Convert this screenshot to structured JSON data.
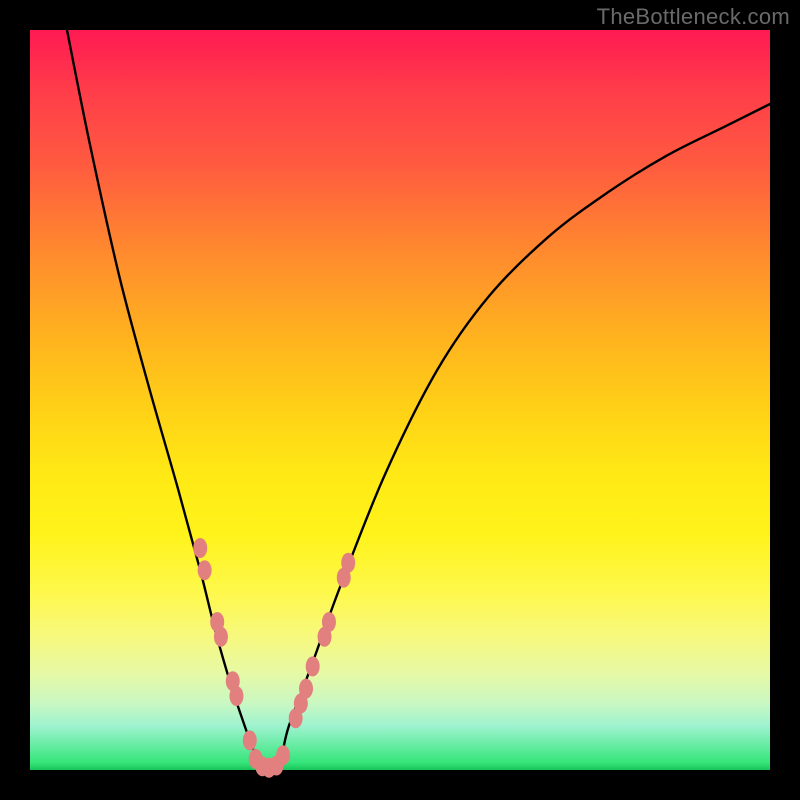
{
  "watermark": "TheBottleneck.com",
  "chart_data": {
    "type": "line",
    "title": "",
    "xlabel": "",
    "ylabel": "",
    "xlim": [
      0,
      100
    ],
    "ylim": [
      0,
      100
    ],
    "grid": false,
    "legend": false,
    "series": [
      {
        "name": "bottleneck-curve",
        "color": "#000000",
        "x": [
          5,
          8,
          12,
          16,
          20,
          23,
          25,
          27,
          29,
          30.5,
          32,
          33,
          34,
          35,
          38,
          42,
          48,
          55,
          62,
          70,
          78,
          86,
          94,
          100
        ],
        "y": [
          100,
          85,
          67,
          52,
          38,
          27,
          19,
          12,
          6,
          2,
          0,
          0,
          2,
          6,
          14,
          25,
          40,
          54,
          64,
          72,
          78,
          83,
          87,
          90
        ]
      }
    ],
    "markers": {
      "name": "highlighted-points",
      "color": "#e28080",
      "points": [
        {
          "x": 23.0,
          "y": 30
        },
        {
          "x": 23.6,
          "y": 27
        },
        {
          "x": 25.3,
          "y": 20
        },
        {
          "x": 25.8,
          "y": 18
        },
        {
          "x": 27.4,
          "y": 12
        },
        {
          "x": 27.9,
          "y": 10
        },
        {
          "x": 29.7,
          "y": 4
        },
        {
          "x": 30.5,
          "y": 1.5
        },
        {
          "x": 31.4,
          "y": 0.5
        },
        {
          "x": 32.3,
          "y": 0.3
        },
        {
          "x": 33.3,
          "y": 0.6
        },
        {
          "x": 34.2,
          "y": 2
        },
        {
          "x": 35.9,
          "y": 7
        },
        {
          "x": 36.6,
          "y": 9
        },
        {
          "x": 37.3,
          "y": 11
        },
        {
          "x": 38.2,
          "y": 14
        },
        {
          "x": 39.8,
          "y": 18
        },
        {
          "x": 40.4,
          "y": 20
        },
        {
          "x": 42.4,
          "y": 26
        },
        {
          "x": 43.0,
          "y": 28
        }
      ]
    },
    "gradient_stops": [
      {
        "pos": 0.0,
        "color": "#ff1a52"
      },
      {
        "pos": 0.5,
        "color": "#ffd316"
      },
      {
        "pos": 0.8,
        "color": "#fef84c"
      },
      {
        "pos": 1.0,
        "color": "#18c45a"
      }
    ]
  }
}
